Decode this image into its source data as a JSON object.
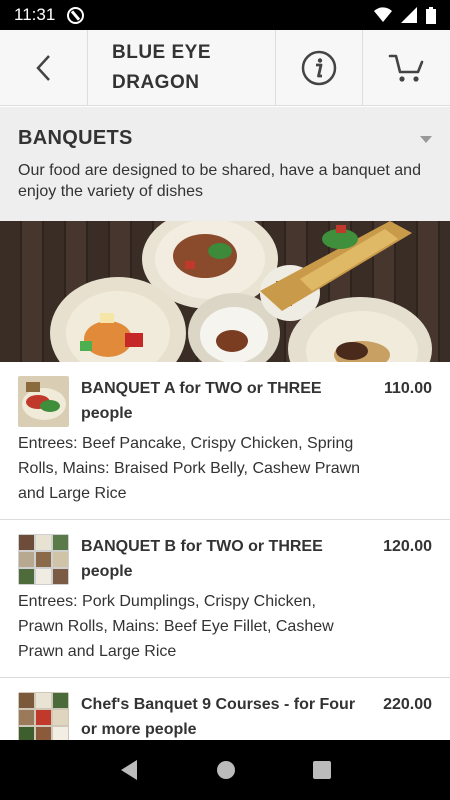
{
  "status_bar": {
    "time": "11:31"
  },
  "header": {
    "title": "BLUE EYE\nDRAGON",
    "back_icon": "chevron-left-icon",
    "info_icon": "info-icon",
    "cart_icon": "cart-icon"
  },
  "section": {
    "title": "BANQUETS",
    "description": "Our food are designed to be shared, have a banquet and enjoy the variety of dishes"
  },
  "items": [
    {
      "name": "BANQUET A for TWO or THREE people",
      "price": "110.00",
      "description": "Entrees: Beef Pancake, Crispy Chicken, Spring Rolls, Mains: Braised Pork Belly, Cashew Prawn and Large Rice"
    },
    {
      "name": "BANQUET B for TWO or THREE people",
      "price": "120.00",
      "description": "Entrees: Pork Dumplings, Crispy Chicken, Prawn Rolls, Mains: Beef Eye Fillet, Cashew Prawn and Large Rice"
    },
    {
      "name": "Chef's Banquet 9 Courses - for Four or more people",
      "price": "220.00",
      "description": ""
    }
  ],
  "colors": {
    "header_bg": "#f7f7f7",
    "section_bg": "#eeeeee",
    "text": "#333333"
  }
}
